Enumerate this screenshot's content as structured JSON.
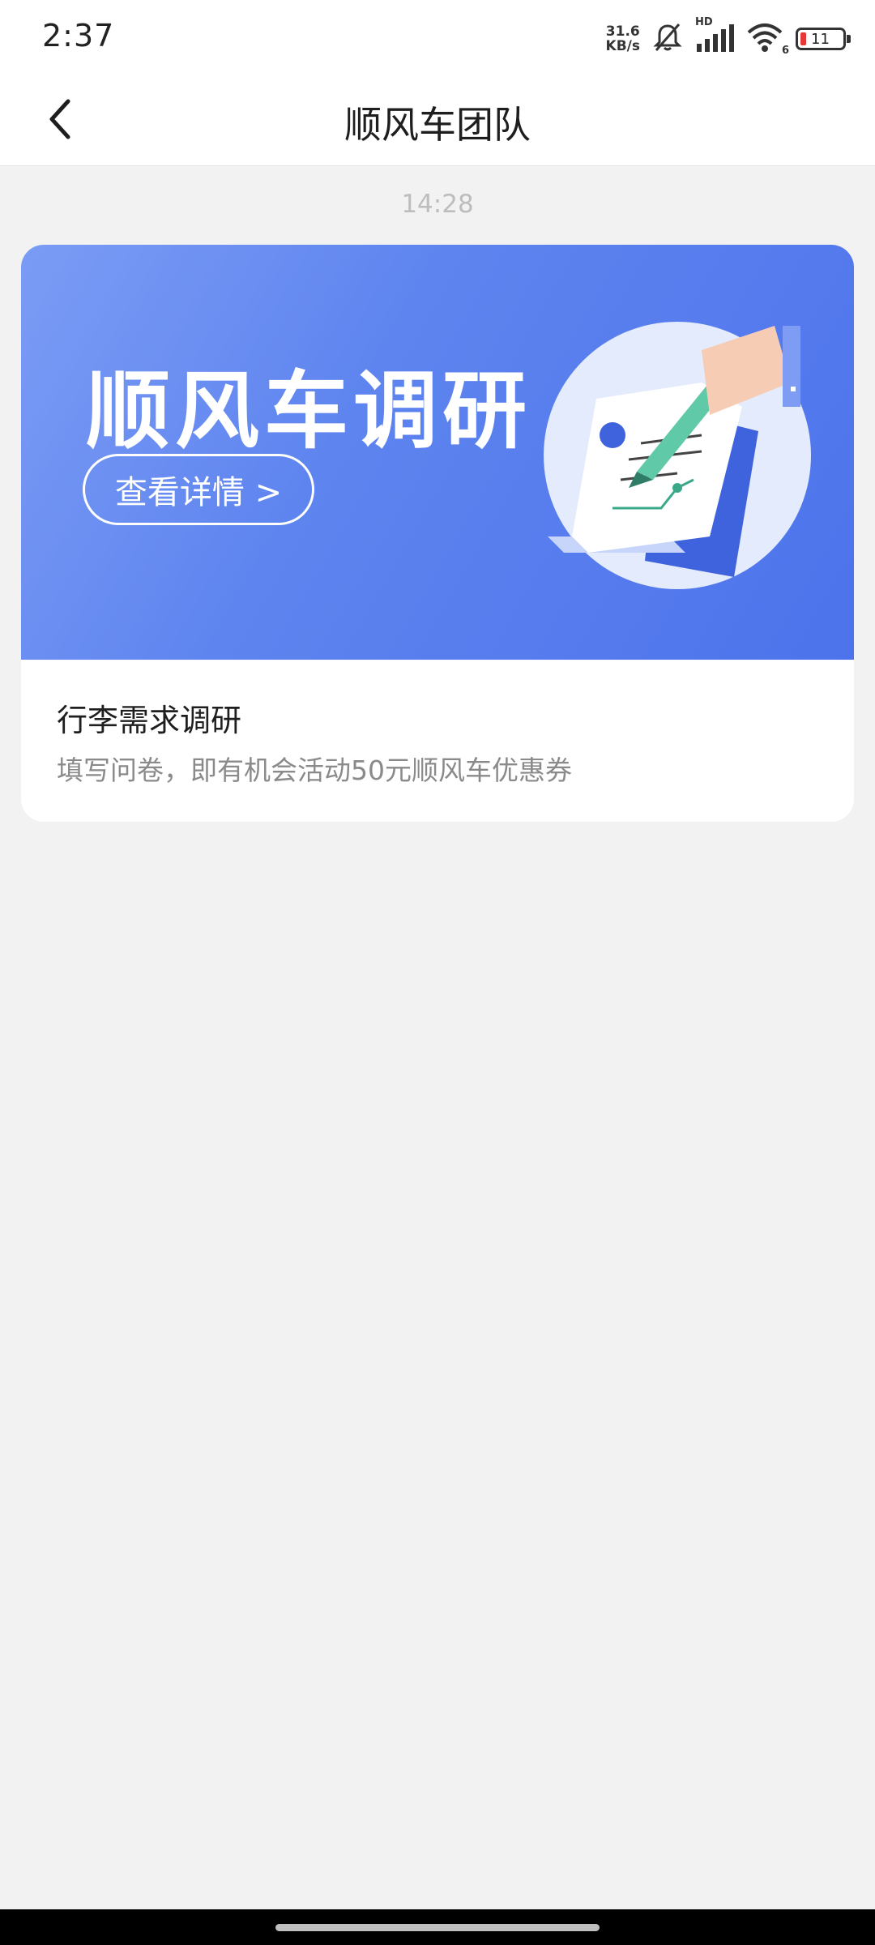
{
  "status_bar": {
    "time": "2:37",
    "net_speed_value": "31.6",
    "net_speed_unit": "KB/s",
    "signal_label": "HD",
    "wifi_label": "6",
    "battery": "11"
  },
  "header": {
    "title": "顺风车团队",
    "back_icon": "chevron-left-icon"
  },
  "chat": {
    "timestamp": "14:28",
    "card": {
      "banner_title": "顺风车调研",
      "banner_button": "查看详情 >",
      "title": "行李需求调研",
      "description": "填写问卷，即有机会活动50元顺风车优惠券"
    }
  },
  "colors": {
    "banner_blue": "#5e84ef",
    "background": "#f2f2f2",
    "battery_low": "#e53935"
  }
}
